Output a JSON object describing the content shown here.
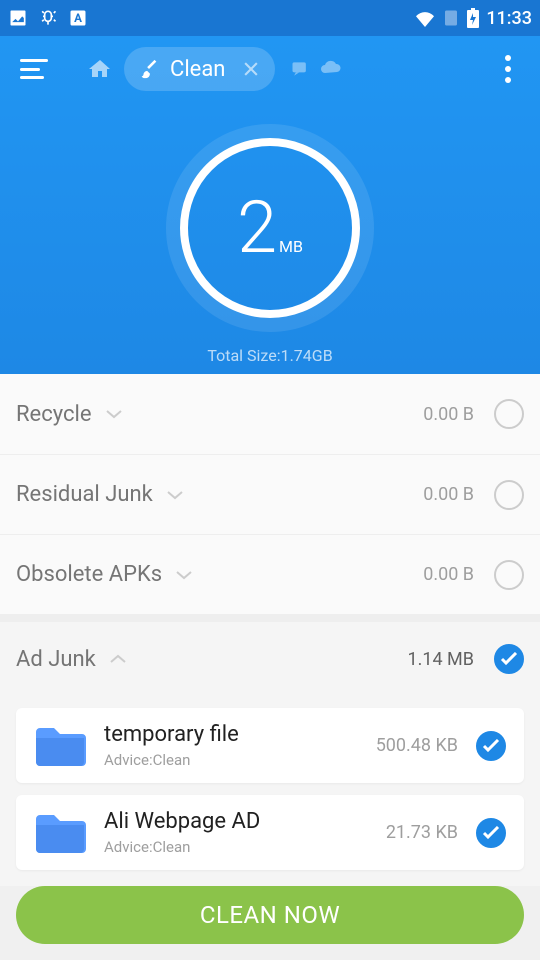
{
  "status_bar": {
    "time": "11:33"
  },
  "header": {
    "tab_label": "Clean",
    "summary_value": "2",
    "summary_unit": "MB",
    "total_label": "Total Size:",
    "total_value": "1.74GB"
  },
  "categories": [
    {
      "label": "Recycle",
      "size": "0.00 B",
      "checked": false,
      "expanded": false
    },
    {
      "label": "Residual Junk",
      "size": "0.00 B",
      "checked": false,
      "expanded": false
    },
    {
      "label": "Obsolete APKs",
      "size": "0.00 B",
      "checked": false,
      "expanded": false
    }
  ],
  "ad_junk": {
    "label": "Ad Junk",
    "size": "1.14 MB",
    "checked": true,
    "items": [
      {
        "name": "temporary file",
        "advice": "Advice:Clean",
        "size": "500.48 KB",
        "checked": true
      },
      {
        "name": "Ali Webpage AD",
        "advice": "Advice:Clean",
        "size": "21.73 KB",
        "checked": true
      }
    ]
  },
  "action": {
    "clean_button": "CLEAN NOW"
  }
}
